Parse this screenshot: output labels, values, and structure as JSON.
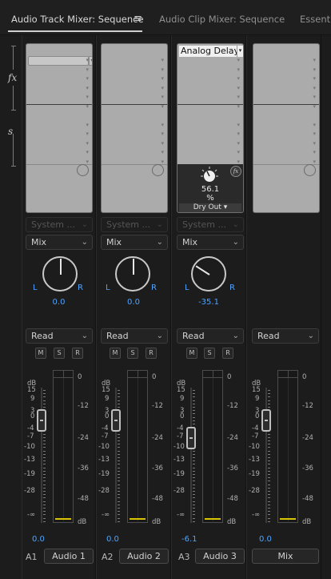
{
  "tabs": [
    {
      "label": "Audio Track Mixer: Sequence",
      "active": true
    },
    {
      "label": "Audio Clip Mixer: Sequence",
      "active": false
    },
    {
      "label": "Essenti",
      "active": false
    }
  ],
  "tab_menu_icon": "≡",
  "side_labels": {
    "fx": "fx",
    "sends": "s"
  },
  "channels": [
    {
      "id": "A1",
      "name": "Audio 1",
      "send": "System ...",
      "mix": "Mix",
      "pan_value": "0.0",
      "pan_angle": 0,
      "automation": "Read",
      "volume": "0.0",
      "fader_db": 0
    },
    {
      "id": "A2",
      "name": "Audio 2",
      "send": "System ...",
      "mix": "Mix",
      "pan_value": "0.0",
      "pan_angle": 0,
      "automation": "Read",
      "volume": "0.0",
      "fader_db": 0
    },
    {
      "id": "A3",
      "name": "Audio 3",
      "send": "System ...",
      "mix": "Mix",
      "pan_value": "-35.1",
      "pan_angle": -35.1,
      "automation": "Read",
      "volume": "-6.1",
      "fader_db": -6.1,
      "effect": {
        "name": "Analog Delay",
        "value": "56.1",
        "unit": "%",
        "param": "Dry Out"
      }
    },
    {
      "id": "",
      "name": "Mix",
      "automation": "Read",
      "volume": "0.0",
      "fader_db": 0
    }
  ],
  "pan_labels": {
    "left": "L",
    "right": "R"
  },
  "msr": [
    "M",
    "S",
    "R"
  ],
  "fader_scale": [
    "dB",
    "15",
    "9",
    "3",
    "0",
    "-4",
    "-7",
    "-10",
    "-13",
    "-19",
    "-28",
    "-∞"
  ],
  "meter_scale": [
    "0",
    "-12",
    "-24",
    "-36",
    "-48",
    "dB"
  ],
  "colors": {
    "accent_blue": "#4da3ff",
    "peak_yellow": "#d8c400",
    "rack_bg": "#ababab"
  }
}
